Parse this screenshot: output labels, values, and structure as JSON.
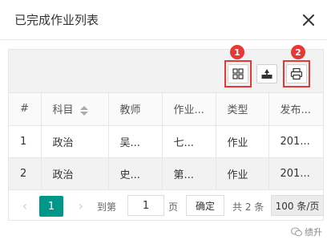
{
  "dialog": {
    "title": "已完成作业列表",
    "close_icon": "close-icon"
  },
  "toolbar": {
    "buttons": [
      {
        "icon": "columns-icon",
        "badge": "1"
      },
      {
        "icon": "export-icon"
      },
      {
        "icon": "print-icon",
        "badge": "2"
      }
    ],
    "highlight_color": "#e53935"
  },
  "table": {
    "headers": [
      "#",
      "科目",
      "教师",
      "作业...",
      "类型",
      "发布..."
    ],
    "rows": [
      [
        "1",
        "政治",
        "吴...",
        "七...",
        "作业",
        "201..."
      ],
      [
        "2",
        "政治",
        "史...",
        "第...",
        "作业",
        "201..."
      ]
    ]
  },
  "pager": {
    "prev": "‹",
    "current": "1",
    "next": "›",
    "goto_label": "到第",
    "input_value": "1",
    "page_label": "页",
    "confirm_label": "确定",
    "total_label": "共 2 条",
    "page_size": "100 条/页",
    "accent_color": "#009688"
  },
  "watermark": {
    "text": "绩升"
  }
}
